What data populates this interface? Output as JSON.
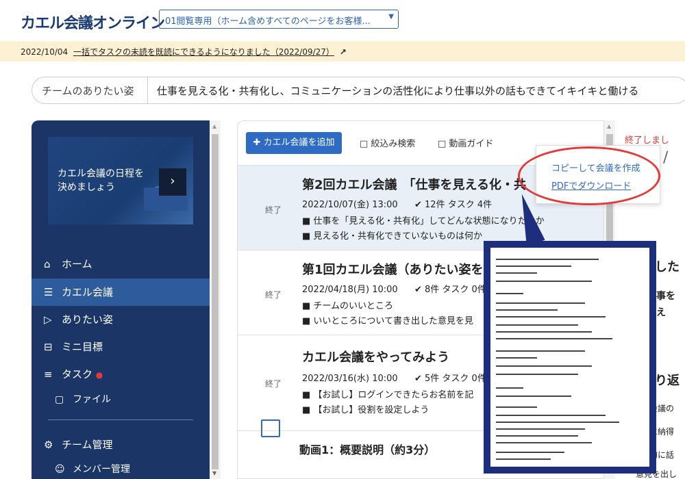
{
  "header": {
    "logo": "カエル会議オンライン",
    "team_select": "01閲覧専用（ホーム含めすべてのページをお客様..."
  },
  "notice": {
    "date": "2022/10/04",
    "link": "一括でタスクの未読を既読にできるようになりました（2022/09/27）"
  },
  "ideal": {
    "label": "チームのありたい姿",
    "text": "仕事を見える化・共有化し、コミュニケーションの活性化により仕事以外の話もできてイキイキと働ける"
  },
  "sidebar": {
    "banner": "カエル会議の日程を決めましょう",
    "items": [
      {
        "icon": "⌂",
        "label": "ホーム"
      },
      {
        "icon": "☰",
        "label": "カエル会議"
      },
      {
        "icon": "▷",
        "label": "ありたい姿"
      },
      {
        "icon": "⊟",
        "label": "ミニ目標"
      },
      {
        "icon": "≡",
        "label": "タスク"
      },
      {
        "icon": "▢",
        "label": "ファイル"
      },
      {
        "icon": "⚙",
        "label": "チーム管理"
      },
      {
        "icon": "☺",
        "label": "メンバー管理"
      }
    ]
  },
  "main": {
    "add_button": "カエル会議を追加",
    "filter": "□ 絞込み検索",
    "guide": "□ 動画ガイド",
    "meetings": [
      {
        "status": "終了",
        "title": "第2回カエル会議　「仕事を見える化・共",
        "date": "2022/10/07(金) 13:00",
        "tasks": "✔ 12件  タスク 4件",
        "agenda1": "■ 仕事を「見える化・共有化」してどんな状態になりたいか",
        "agenda2": "■ 見える化・共有化できていないものは何か"
      },
      {
        "status": "終了",
        "title": "第1回カエル会議（ありたい姿を",
        "date": "2022/04/18(月) 10:00",
        "tasks": "✔ 8件  タスク 0件",
        "agenda1": "■ チームのいいところ",
        "agenda2": "■ いいところについて書き出した意見を見"
      },
      {
        "status": "終了",
        "title": "カエル会議をやってみよう",
        "date": "2022/03/16(水) 10:00",
        "tasks": "✔ 5件  タスク 0件",
        "agenda1": "■ 【お試し】ログインできたらお名前を記",
        "agenda2": "■ 【お試し】役割を設定しよう"
      }
    ],
    "movie": "動画1：概要説明（約3分）"
  },
  "popup": {
    "copy": "コピーして会議を作成",
    "pdf": "PDFでダウンロード"
  },
  "right": {
    "r1": "終了しまし",
    "r2": "/",
    "r3": "話した",
    "r4": "仕事を",
    "r5": "見え",
    "r6": "振り返",
    "r7": "の会議の",
    "r8": "題に納得",
    "r9": "方的に話",
    "r10": "意見を出し"
  }
}
